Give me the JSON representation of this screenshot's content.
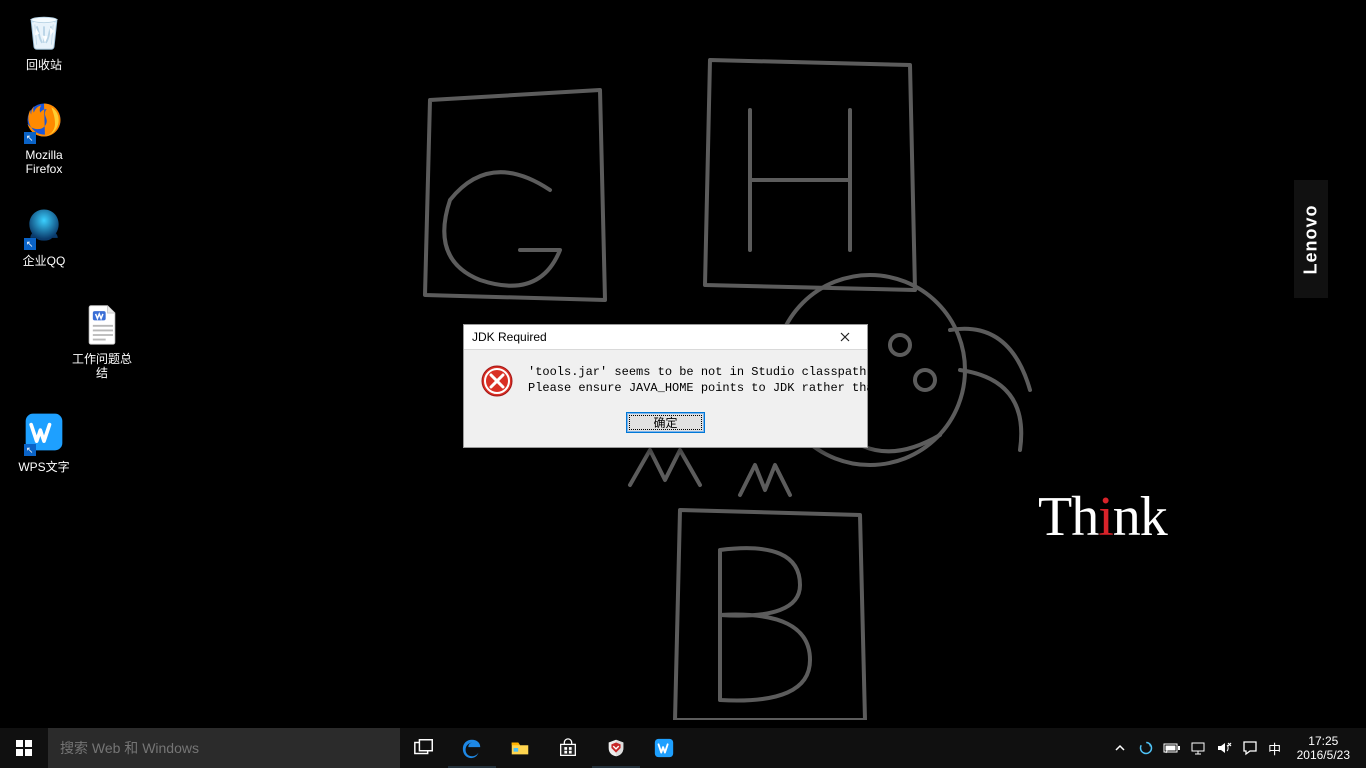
{
  "wallpaper": {
    "think_text_pre": "Th",
    "think_text_post": "nk",
    "lenovo_text": "Lenovo"
  },
  "desktop": {
    "icons": [
      {
        "name": "recycle-bin",
        "label": "回收站"
      },
      {
        "name": "firefox",
        "label": "Mozilla\nFirefox"
      },
      {
        "name": "enterprise-qq",
        "label": "企业QQ"
      },
      {
        "name": "work-doc",
        "label": "工作问题总\n结"
      },
      {
        "name": "wps-writer",
        "label": "WPS文字"
      }
    ]
  },
  "dialog": {
    "title": "JDK Required",
    "message": "'tools.jar' seems to be not in Studio classpath.\nPlease ensure JAVA_HOME points to JDK rather than JRE.",
    "ok_label": "确定"
  },
  "taskbar": {
    "search_placeholder": "搜索 Web 和 Windows",
    "ime_label": "中",
    "time": "17:25",
    "date": "2016/5/23"
  }
}
